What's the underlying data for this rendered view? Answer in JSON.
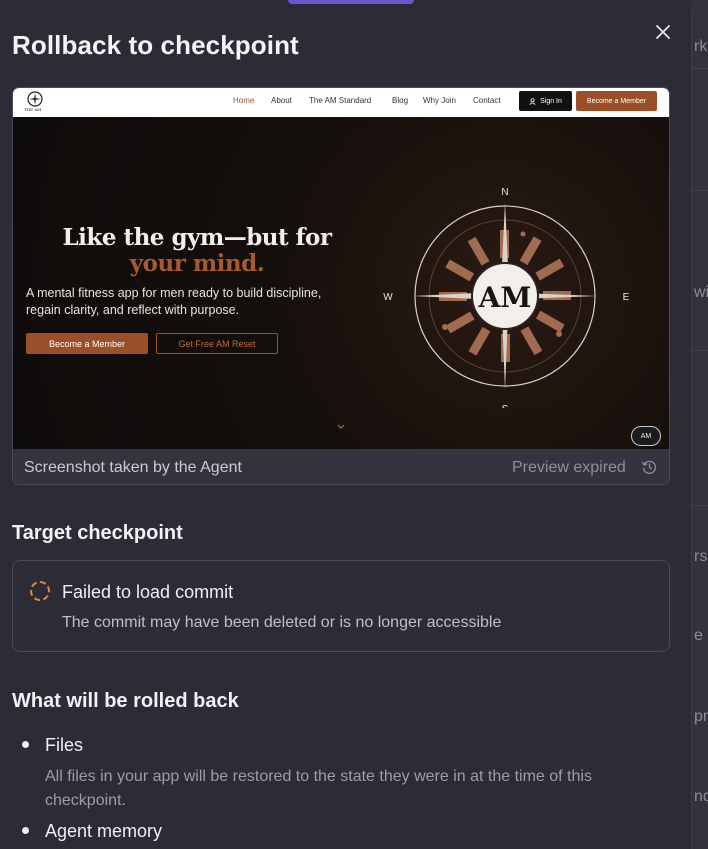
{
  "background": {
    "fragments": [
      "rk",
      "wit",
      "rs",
      "e la",
      "pr",
      "nd"
    ]
  },
  "modal": {
    "title": "Rollback to checkpoint",
    "close_icon": "close-icon"
  },
  "screenshot": {
    "site": {
      "logo_text": "THE AM",
      "nav": [
        "Home",
        "About",
        "The AM Standard",
        "Blog",
        "Why Join",
        "Contact"
      ],
      "active_nav": "Home",
      "sign_in": "Sign In",
      "become_member": "Become a Member",
      "hero_title_line1": "Like the gym—but for",
      "hero_title_line2": "your mind.",
      "hero_desc": "A mental fitness app for men ready to build discipline, regain clarity, and reflect with purpose.",
      "btn_primary": "Become a Member",
      "btn_secondary": "Get Free AM Reset",
      "compass_center": "AM",
      "compass_n": "N",
      "compass_s": "S",
      "compass_e": "E",
      "compass_w": "W",
      "badge": "AM"
    },
    "caption": "Screenshot taken by the Agent",
    "status": "Preview expired",
    "accent": "#9b4f27"
  },
  "target_checkpoint": {
    "heading": "Target checkpoint",
    "title": "Failed to load commit",
    "subtitle": "The commit may have been deleted or is no longer accessible",
    "spinner_color": "#e0853a"
  },
  "rollback": {
    "heading": "What will be rolled back",
    "items": [
      {
        "title": "Files",
        "desc": "All files in your app will be restored to the state they were in at the time of this checkpoint."
      },
      {
        "title": "Agent memory",
        "desc": ""
      }
    ]
  }
}
